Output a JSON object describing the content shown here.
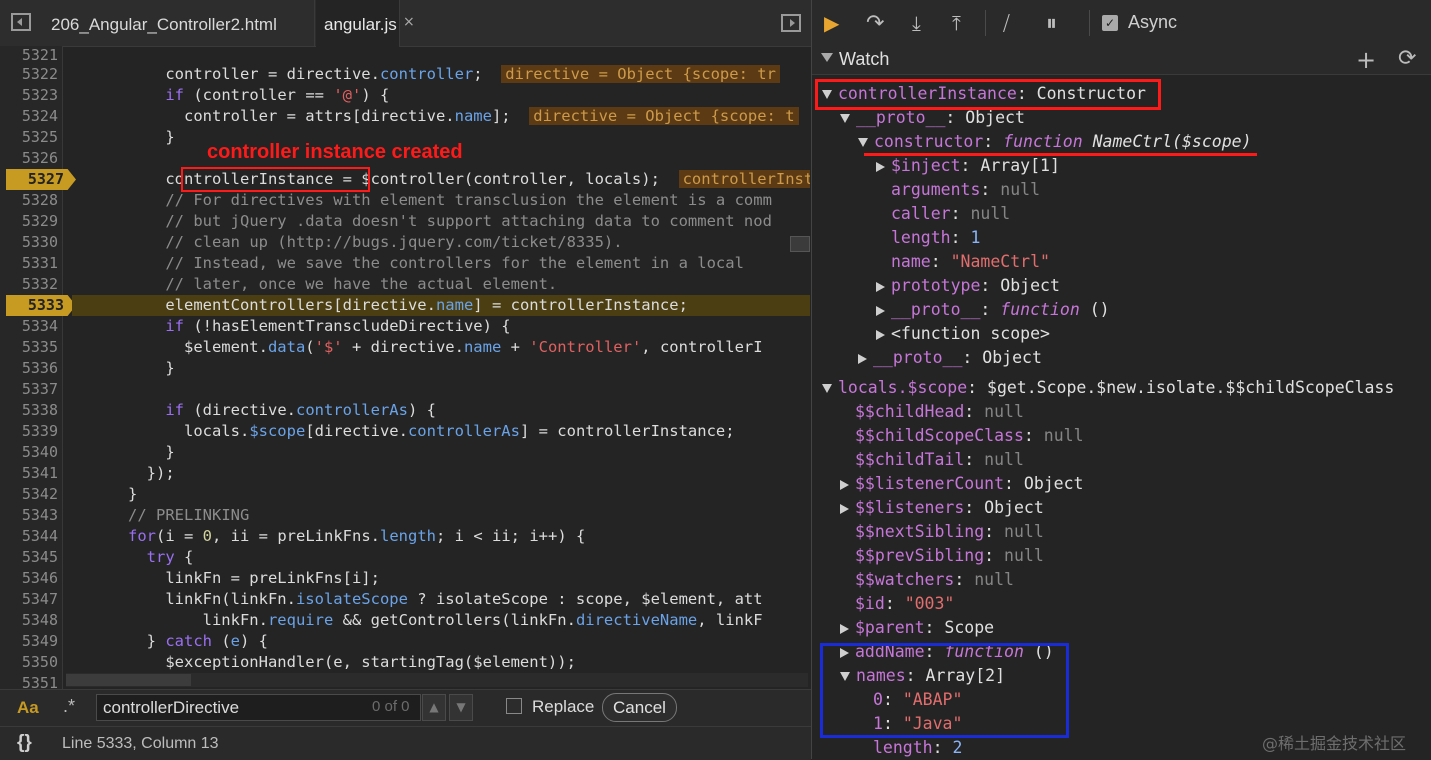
{
  "tabs": [
    {
      "label": "206_Angular_Controller2.html"
    },
    {
      "label": "angular.js",
      "close": "×"
    }
  ],
  "code": {
    "lines": [
      {
        "n": "5321"
      },
      {
        "n": "5322"
      },
      {
        "n": "5323"
      },
      {
        "n": "5324"
      },
      {
        "n": "5325"
      },
      {
        "n": "5326"
      },
      {
        "n": "5327"
      },
      {
        "n": "5328"
      },
      {
        "n": "5329"
      },
      {
        "n": "5330"
      },
      {
        "n": "5331"
      },
      {
        "n": "5332"
      },
      {
        "n": "5333"
      },
      {
        "n": "5334"
      },
      {
        "n": "5335"
      },
      {
        "n": "5336"
      },
      {
        "n": "5337"
      },
      {
        "n": "5338"
      },
      {
        "n": "5339"
      },
      {
        "n": "5340"
      },
      {
        "n": "5341"
      },
      {
        "n": "5342"
      },
      {
        "n": "5343"
      },
      {
        "n": "5344"
      },
      {
        "n": "5345"
      },
      {
        "n": "5346"
      },
      {
        "n": "5347"
      },
      {
        "n": "5348"
      },
      {
        "n": "5349"
      },
      {
        "n": "5350"
      },
      {
        "n": "5351"
      }
    ],
    "annotation": "controller instance created"
  },
  "search": {
    "aa": "Aa",
    "regex": ".*",
    "value": "controllerDirective",
    "count": "0 of 0",
    "up": "▲",
    "down": "▼",
    "replace_label": "Replace",
    "cancel_label": "Cancel"
  },
  "status": {
    "braces": "{}",
    "position": "Line 5333, Column 13"
  },
  "debugger": {
    "async_label": "Async",
    "async_check": "✓"
  },
  "watch": {
    "title": "Watch",
    "add": "+",
    "refresh": "⟳"
  },
  "watermark": "@稀土掘金技术社区"
}
